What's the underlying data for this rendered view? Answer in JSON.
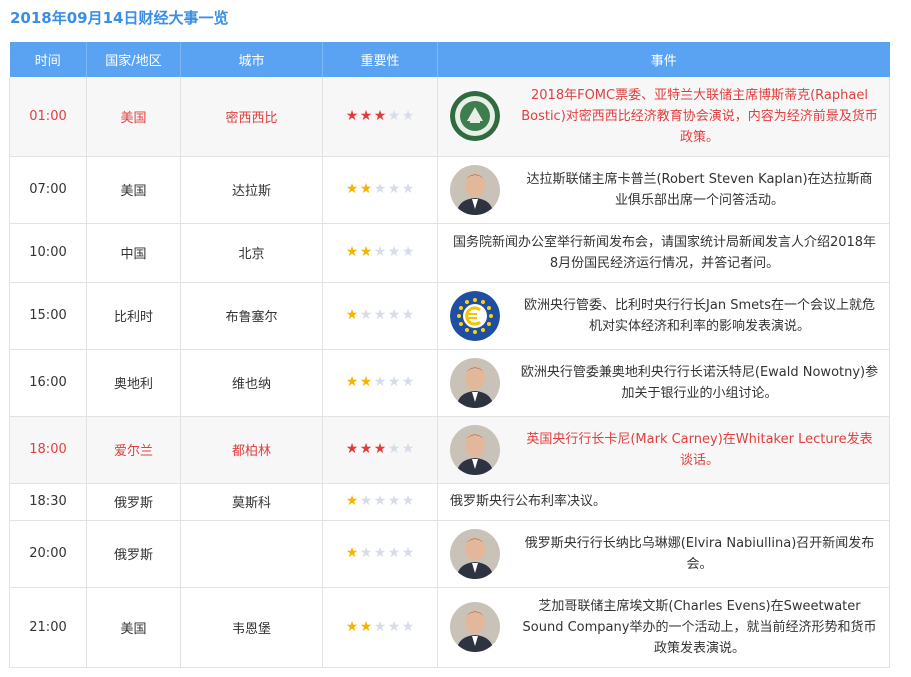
{
  "page": {
    "title": "2018年09月14日财经大事一览"
  },
  "table": {
    "headers": {
      "time": "时间",
      "country": "国家/地区",
      "city": "城市",
      "importance": "重要性",
      "event": "事件"
    },
    "rows": [
      {
        "time": "01:00",
        "country": "美国",
        "city": "密西西比",
        "stars": 3,
        "highlight": true,
        "avatar": "fed-seal-icon",
        "event": "2018年FOMC票委、亚特兰大联储主席博斯蒂克(Raphael Bostic)对密西西比经济教育协会演说，内容为经济前景及货币政策。"
      },
      {
        "time": "07:00",
        "country": "美国",
        "city": "达拉斯",
        "stars": 2,
        "highlight": false,
        "avatar": "portrait-icon",
        "event": "达拉斯联储主席卡普兰(Robert Steven Kaplan)在达拉斯商业俱乐部出席一个问答活动。"
      },
      {
        "time": "10:00",
        "country": "中国",
        "city": "北京",
        "stars": 2,
        "highlight": false,
        "avatar": "",
        "event": "国务院新闻办公室举行新闻发布会，请国家统计局新闻发言人介绍2018年8月份国民经济运行情况，并答记者问。"
      },
      {
        "time": "15:00",
        "country": "比利时",
        "city": "布鲁塞尔",
        "stars": 1,
        "highlight": false,
        "avatar": "euro-icon",
        "event": "欧洲央行管委、比利时央行行长Jan Smets在一个会议上就危机对实体经济和利率的影响发表演说。"
      },
      {
        "time": "16:00",
        "country": "奥地利",
        "city": "维也纳",
        "stars": 2,
        "highlight": false,
        "avatar": "portrait-icon",
        "event": "欧洲央行管委兼奥地利央行行长诺沃特尼(Ewald Nowotny)参加关于银行业的小组讨论。"
      },
      {
        "time": "18:00",
        "country": "爱尔兰",
        "city": "都柏林",
        "stars": 3,
        "highlight": true,
        "avatar": "portrait-icon",
        "event": "英国央行行长卡尼(Mark Carney)在Whitaker Lecture发表谈话。"
      },
      {
        "time": "18:30",
        "country": "俄罗斯",
        "city": "莫斯科",
        "stars": 1,
        "highlight": false,
        "avatar": "",
        "event": "俄罗斯央行公布利率决议。"
      },
      {
        "time": "20:00",
        "country": "俄罗斯",
        "city": "",
        "stars": 1,
        "highlight": false,
        "avatar": "portrait-icon",
        "event": "俄罗斯央行行长纳比乌琳娜(Elvira Nabiullina)召开新闻发布会。"
      },
      {
        "time": "21:00",
        "country": "美国",
        "city": "韦恩堡",
        "stars": 2,
        "highlight": false,
        "avatar": "portrait-icon",
        "event": "芝加哥联储主席埃文斯(Charles Evens)在Sweetwater Sound Company举办的一个活动上，就当前经济形势和货币政策发表演说。"
      }
    ],
    "max_stars": 5
  },
  "colors": {
    "header_bg": "#5aa2f2",
    "title": "#3a8ee6",
    "highlight_text": "#e0403f",
    "star_red": "#e23b3b",
    "star_yellow": "#f4b400",
    "star_off": "#d6dde8"
  }
}
